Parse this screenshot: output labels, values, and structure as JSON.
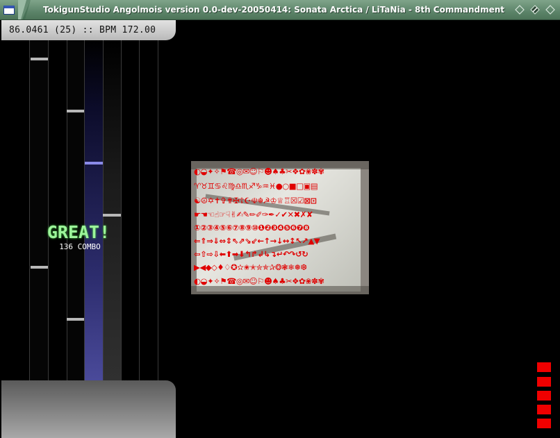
{
  "window": {
    "title": "TokigunStudio Angolmois version 0.0-dev-20050414: Sonata Arctica / LiTaNia - 8th Commandment"
  },
  "hud": {
    "status": "86.0461 (25) :: BPM 172.00"
  },
  "judgement": {
    "grade": "GREAT!",
    "combo": "136 COMBO"
  },
  "bga": {
    "rows": [
      "◐◒✦✧⚑☎◎✉☺⚐☻♠♣✂❖✿❀✽✾",
      "♈♉♊♋♌♍♎♏♐♑♒♓●○■□▣▤",
      "☯☮✡✝✞✟✠☦☪☫☬☭♔♕♖☒☑⊠⊡",
      "☛☚☜☝☞☟✌✍✎✏✐✑✒✓✔✕✖✗✘",
      "①②③④⑤⑥⑦⑧⑨⑩❶❷❸❹❺❻❼❽",
      "⇐⇑⇒⇓⇔⇕⇖⇗⇘⇙←↑→↓↔↕↖↗▲▼",
      "⇦⇧⇨⇩⬅⬆➡⬇↰↱↲↳↴↵↶↷↺↻",
      "▶◀◆◇♦♢✪✫✬✭✮✯✰❂❃❄❅❆"
    ]
  },
  "colors": {
    "judge": "#9cf59a",
    "active_lane": "#3a3a8c",
    "life": "#f00000"
  }
}
